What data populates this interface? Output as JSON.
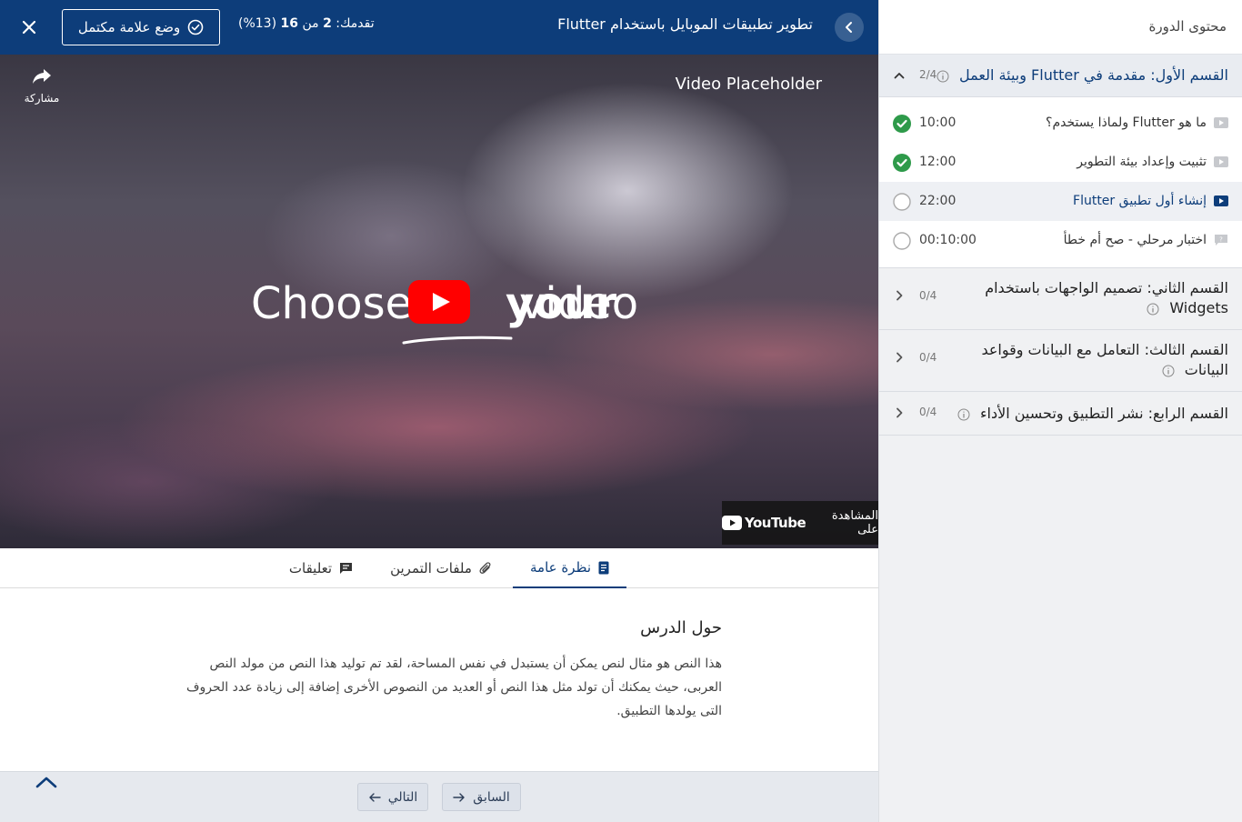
{
  "topbar": {
    "mark_complete_label": "وضع علامة مكتمل",
    "progress_prefix": "تقدمك:",
    "progress_done": "2",
    "progress_of": "من",
    "progress_total": "16",
    "progress_percent": "(13%)",
    "course_title": "تطوير تطبيقات الموبايل باستخدام Flutter"
  },
  "video": {
    "share_label": "مشاركة",
    "placeholder_label": "Video Placeholder",
    "headline_word_1": "Choose",
    "headline_word_2": "your",
    "headline_word_3": "video",
    "watch_on_label": "المشاهدة على",
    "youtube_label": "YouTube"
  },
  "tabs": [
    {
      "label": "نظرة عامة",
      "icon": "document-icon",
      "active": true
    },
    {
      "label": "ملفات التمرين",
      "icon": "paperclip-icon",
      "active": false
    },
    {
      "label": "تعليقات",
      "icon": "comment-icon",
      "active": false
    }
  ],
  "content": {
    "heading": "حول الدرس",
    "body": "هذا النص هو مثال لنص يمكن أن يستبدل في نفس المساحة، لقد تم توليد هذا النص من مولد النص العربى، حيث يمكنك أن تولد مثل هذا النص أو العديد من النصوص الأخرى إضافة إلى زيادة عدد الحروف التى يولدها التطبيق."
  },
  "footer": {
    "prev_label": "السابق",
    "next_label": "التالي"
  },
  "sidebar": {
    "header": "محتوى الدورة",
    "sections": [
      {
        "title": "القسم الأول: مقدمة في Flutter وبيئة العمل",
        "count": "2/4",
        "expanded": true,
        "lessons": [
          {
            "title": "ما هو Flutter ولماذا يستخدم؟",
            "duration": "10:00",
            "type": "video",
            "completed": true
          },
          {
            "title": "تثبيت وإعداد بيئة التطوير",
            "duration": "12:00",
            "type": "video",
            "completed": true
          },
          {
            "title": "إنشاء أول تطبيق Flutter",
            "duration": "22:00",
            "type": "video",
            "completed": false,
            "current": true
          },
          {
            "title": "اختبار مرحلي - صح أم خطأ",
            "duration": "00:10:00",
            "type": "quiz",
            "completed": false
          }
        ]
      },
      {
        "title": "القسم الثاني: تصميم الواجهات باستخدام Widgets",
        "count": "0/4",
        "expanded": false
      },
      {
        "title": "القسم الثالث: التعامل مع البيانات وقواعد البيانات",
        "count": "0/4",
        "expanded": false
      },
      {
        "title": "القسم الرابع: نشر التطبيق وتحسين الأداء",
        "count": "0/4",
        "expanded": false
      }
    ]
  },
  "colors": {
    "primary": "#0d3d7a",
    "complete_green": "#2e9a4a",
    "youtube_red": "#ff0000"
  }
}
